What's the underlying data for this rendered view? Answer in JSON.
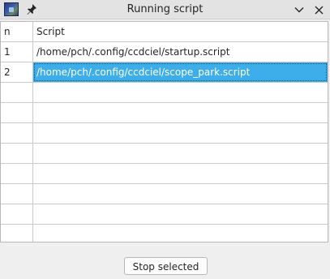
{
  "window": {
    "title": "Running script",
    "icons": {
      "app": "app-icon",
      "pin": "pin-icon",
      "minimize": "chevron-down-icon",
      "close": "close-icon"
    }
  },
  "table": {
    "columns": [
      "n",
      "Script"
    ],
    "rows": [
      {
        "n": "1",
        "script": "/home/pch/.config/ccdciel/startup.script"
      },
      {
        "n": "2",
        "script": "/home/pch/.config/ccdciel/scope_park.script"
      }
    ],
    "selected_row_index": 1,
    "selection_color": "#3daee9"
  },
  "footer": {
    "stop_label": "Stop selected"
  }
}
